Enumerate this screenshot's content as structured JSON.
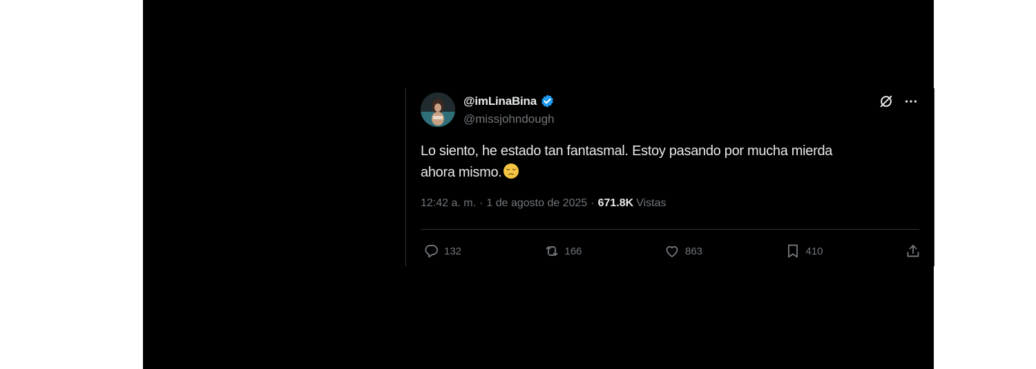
{
  "tweet": {
    "author": {
      "display_name": "@imLinaBina",
      "handle": "@missjohndough",
      "verified": true,
      "avatar_icon": "profile-photo"
    },
    "text_line1": "Lo siento, he estado tan fantasmal. Estoy pasando por mucha mierda",
    "text_line2": "ahora mismo.",
    "emoji": "pensive-face-emoji",
    "meta": {
      "time": "12:42 a. m.",
      "separator": "·",
      "date": "1 de agosto de 2025",
      "views_count": "671.8K",
      "views_label": "Vistas"
    },
    "top_icons": [
      "grok-icon",
      "more-icon"
    ],
    "actions": {
      "replies": "132",
      "reposts": "166",
      "likes": "863",
      "bookmarks": "410"
    }
  },
  "colors": {
    "background": "#000000",
    "text": "#e7e9ea",
    "secondary": "#71767b",
    "verified": "#1d9bf0",
    "border": "#2f3336"
  }
}
